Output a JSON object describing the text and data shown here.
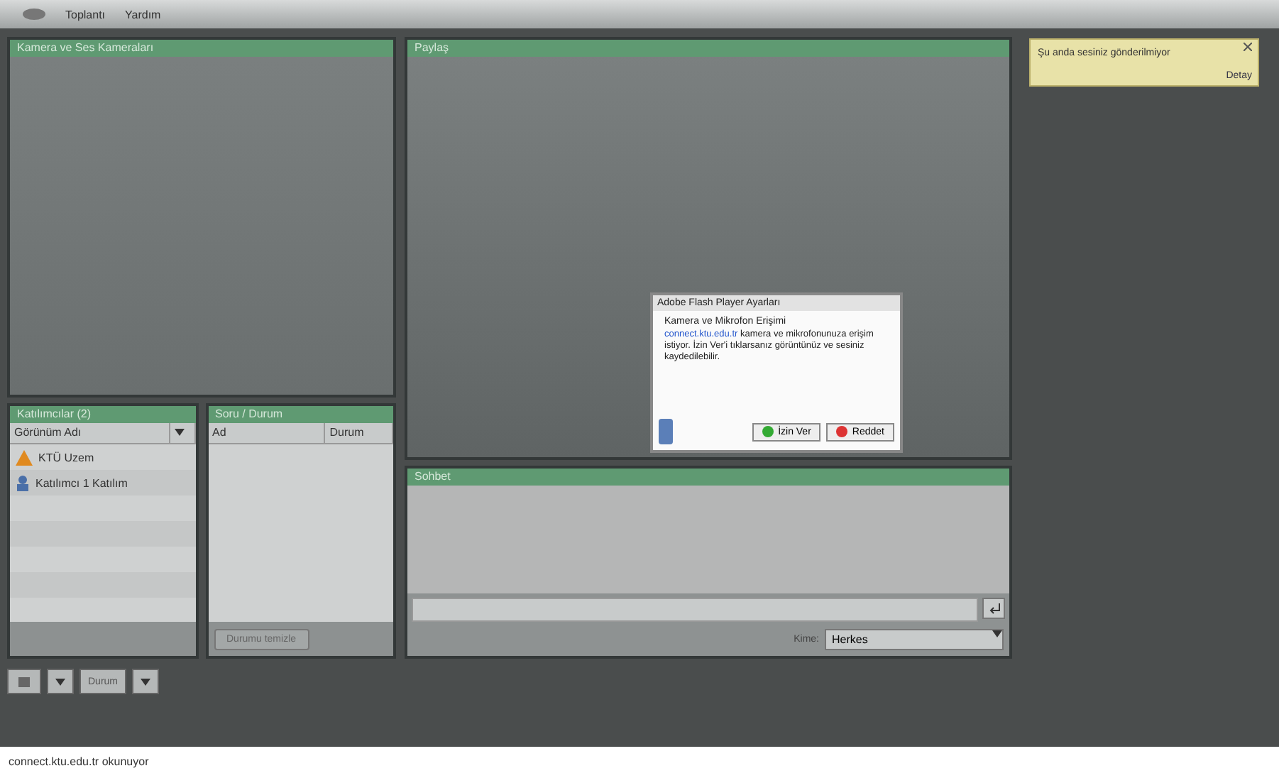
{
  "menu": [
    "Toplantı",
    "Yardım"
  ],
  "video_panel": {
    "title": "Kamera ve Ses Kameraları"
  },
  "share_panel": {
    "title": "Paylaş"
  },
  "attendees": {
    "title": "Katılımcılar (2)",
    "column": "Görünüm Adı",
    "items": [
      {
        "name": "KTÜ Uzem",
        "kind": "host"
      },
      {
        "name": "Katılımcı 1 Katılım",
        "kind": "guest"
      }
    ]
  },
  "notes_panel": {
    "title": "Soru / Durum",
    "columns": [
      "Ad",
      "Durum"
    ],
    "button": "Durumu temizle"
  },
  "chat": {
    "title": "Sohbet",
    "to_label": "Kime:",
    "to_value": "Herkes"
  },
  "toolbar": {
    "status": "Durum"
  },
  "dialog": {
    "title": "Adobe Flash Player Ayarları",
    "heading": "Kamera ve Mikrofon Erişimi",
    "link": "connect.ktu.edu.tr",
    "body": " kamera ve mikrofonunuza erişim istiyor. İzin Ver'i tıklarsanız görüntünüz ve sesiniz kaydedilebilir.",
    "buttons": [
      {
        "label": "İzin Ver",
        "kind": "allow"
      },
      {
        "label": "Reddet",
        "kind": "deny"
      }
    ]
  },
  "notification": {
    "text": "Şu anda sesiniz gönderilmiyor",
    "link": "Detay"
  },
  "status_bar": "connect.ktu.edu.tr okunuyor"
}
